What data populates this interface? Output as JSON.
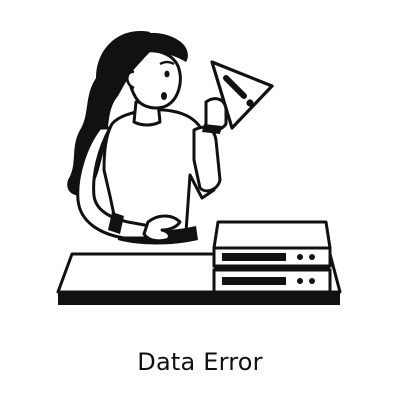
{
  "caption": "Data Error",
  "illustration": {
    "subject": "woman-holding-warning-sign",
    "icons": [
      "warning-sign-icon",
      "server-icon"
    ],
    "ink_color": "#111111",
    "paper_color": "#ffffff"
  }
}
